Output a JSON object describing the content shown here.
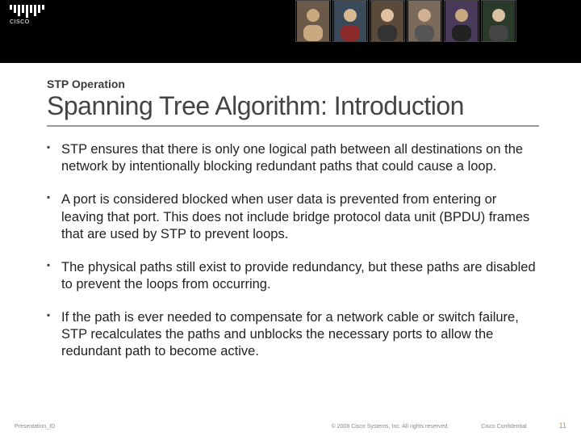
{
  "brand": {
    "name": "CISCO"
  },
  "header": {
    "pretitle": "STP Operation",
    "title": "Spanning Tree Algorithm: Introduction"
  },
  "bullets": [
    "STP ensures that there is only one logical path between all destinations on the network by intentionally blocking redundant paths that could cause a loop.",
    "A port is considered blocked when user data is prevented from entering or leaving that port. This does not include bridge protocol data unit (BPDU) frames that are used by STP to prevent loops.",
    "The physical paths still exist to provide redundancy, but these paths are disabled to prevent the loops from occurring.",
    "If the path is ever needed to compensate for a network cable or switch failure, STP recalculates the paths and unblocks the necessary ports to allow the redundant path to become active."
  ],
  "footer": {
    "presentation_id": "Presentation_ID",
    "copyright": "© 2008 Cisco Systems, Inc. All rights reserved.",
    "confidential": "Cisco Confidential",
    "page": "11"
  }
}
